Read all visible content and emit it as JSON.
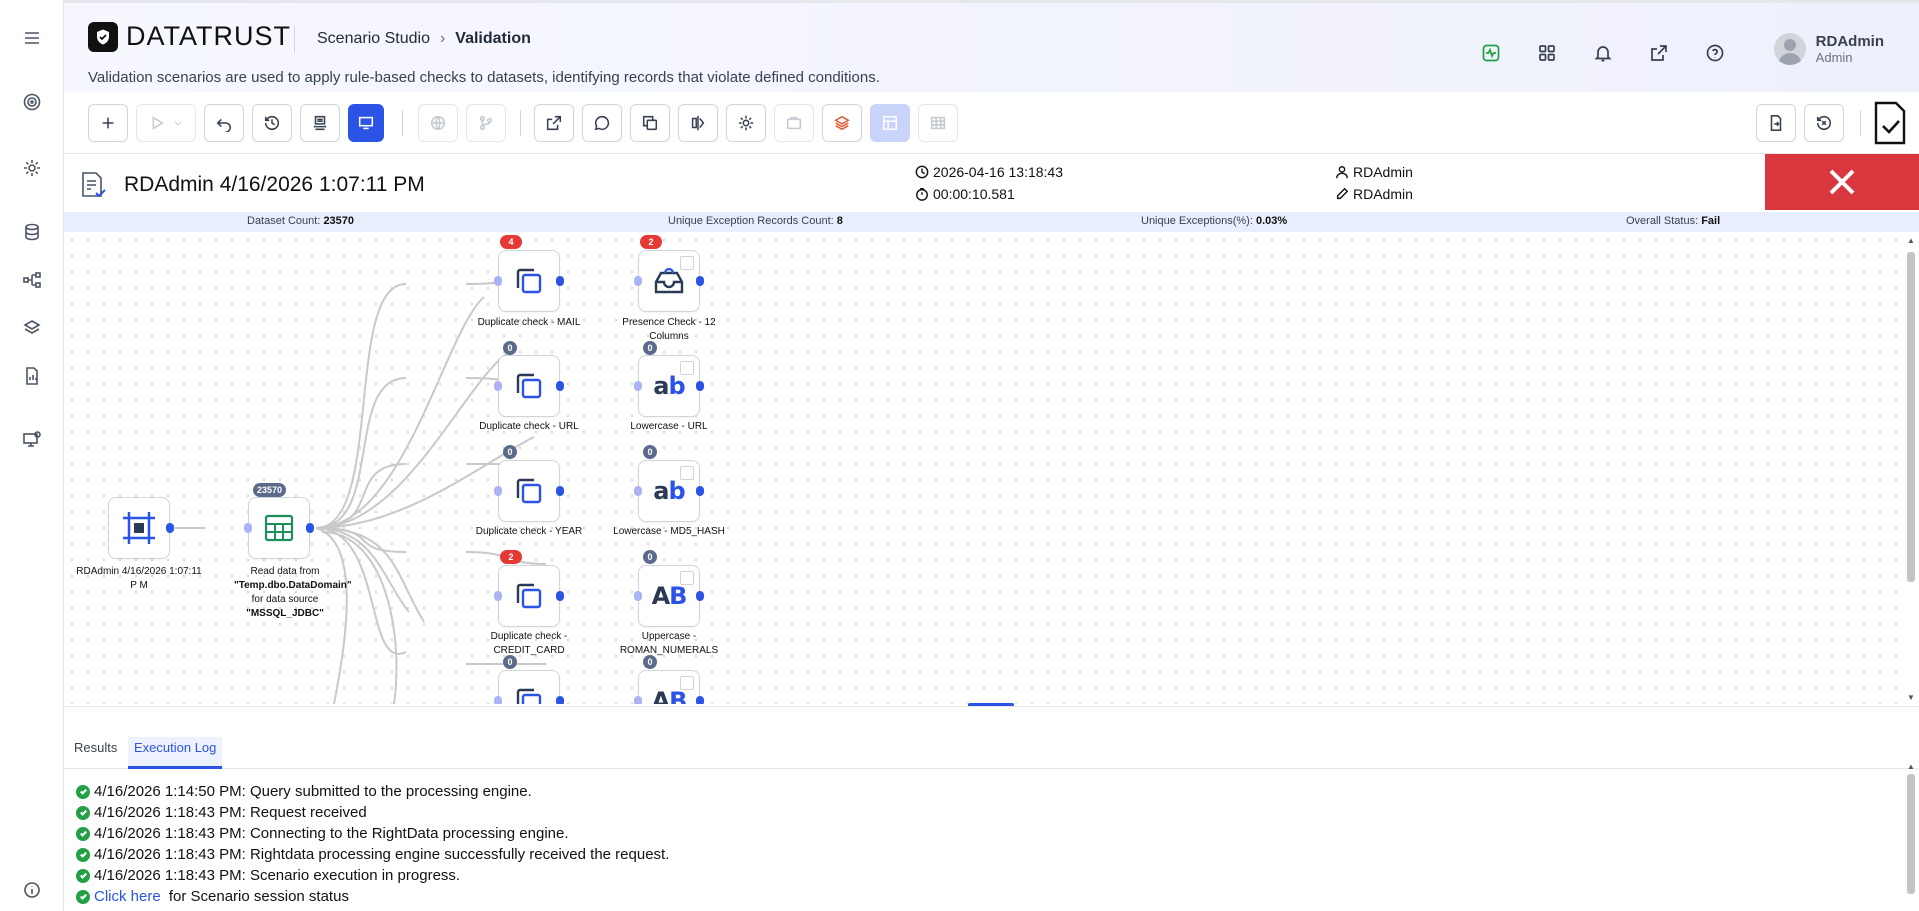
{
  "app": {
    "logo": "DATATRUST",
    "breadcrumb": [
      "Scenario Studio",
      "Validation"
    ],
    "description": "Validation scenarios are used to apply rule-based checks to datasets, identifying records that violate defined conditions."
  },
  "user": {
    "name": "RDAdmin",
    "role": "Admin"
  },
  "run": {
    "title": "RDAdmin 4/16/2026 1:07:11 PM",
    "timestamp": "2026-04-16 13:18:43",
    "duration": "00:00:10.581",
    "created_by": "RDAdmin",
    "modified_by": "RDAdmin",
    "status_icon": "close-icon"
  },
  "stats": {
    "dataset_count_label": "Dataset Count:",
    "dataset_count": "23570",
    "unique_exc_label": "Unique Exception Records Count:",
    "unique_exc": "8",
    "unique_pct_label": "Unique Exceptions(%):",
    "unique_pct": "0.03%",
    "overall_label": "Overall Status:",
    "overall": "Fail"
  },
  "nodes": {
    "source": {
      "label": "RDAdmin 4/16/2026 1:07:11 P M"
    },
    "read": {
      "badge": "23570",
      "label_pre": "Read data from ",
      "label_table": "\"Temp.dbo.DataDomain\"",
      "label_mid": " for data source ",
      "label_src": "\"MSSQL_JDBC\""
    },
    "dup_mail": {
      "badge": "4",
      "label": "Duplicate check - MAIL"
    },
    "presence": {
      "badge": "2",
      "label": "Presence Check - 12 Columns"
    },
    "dup_url": {
      "badge": "0",
      "label": "Duplicate check - URL"
    },
    "lower_url": {
      "badge": "0",
      "label": "Lowercase - URL",
      "glyph_a": "a",
      "glyph_b": "b"
    },
    "dup_year": {
      "badge": "0",
      "label": "Duplicate check - YEAR"
    },
    "lower_md5": {
      "badge": "0",
      "label": "Lowercase - MD5_HASH",
      "glyph_a": "a",
      "glyph_b": "b"
    },
    "dup_cc": {
      "badge": "2",
      "label": "Duplicate check - CREDIT_CARD"
    },
    "upper_roman": {
      "badge": "0",
      "label": "Uppercase - ROMAN_NUMERALS",
      "glyph_a": "A",
      "glyph_b": "B"
    },
    "dup_next": {
      "badge": "0"
    },
    "upper_next": {
      "badge": "0",
      "glyph_a": "A",
      "glyph_b": "B"
    }
  },
  "tabs": [
    "Results",
    "Execution Log"
  ],
  "log": [
    {
      "time": "4/16/2026 1:14:50 PM",
      "msg": ": Query submitted to the processing engine."
    },
    {
      "time": "4/16/2026 1:18:43 PM",
      "msg": ": Request received"
    },
    {
      "time": "4/16/2026 1:18:43 PM",
      "msg": ": Connecting to the RightData processing engine."
    },
    {
      "time": "4/16/2026 1:18:43 PM",
      "msg": ": Rightdata processing engine successfully received the request."
    },
    {
      "time": "4/16/2026 1:18:43 PM",
      "msg": ": Scenario execution in progress."
    }
  ],
  "log_last": {
    "link": "Click here",
    "rest": " for Scenario session status"
  },
  "colors": {
    "accent": "#2b54e6",
    "fail": "#d9363e",
    "ok": "#22a046"
  }
}
